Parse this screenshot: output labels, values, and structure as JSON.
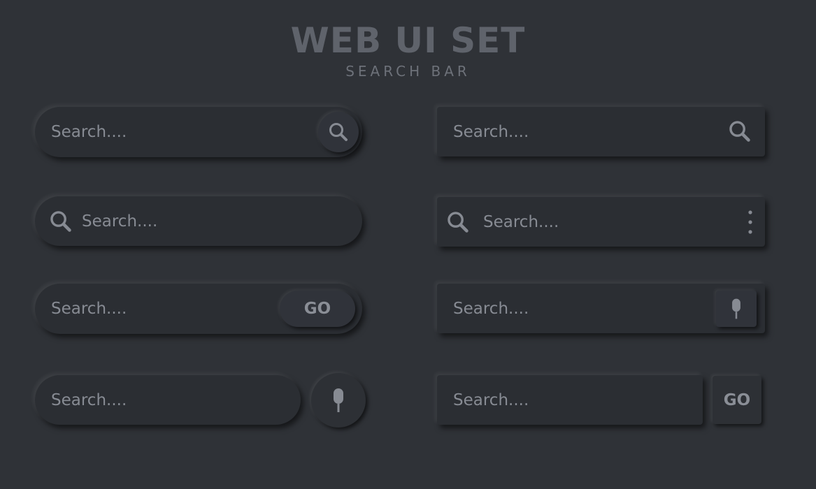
{
  "header": {
    "title": "WEB UI SET",
    "subtitle": "SEARCH BAR"
  },
  "search_bars": {
    "left_1": {
      "placeholder": "Search....",
      "icon": "search-icon"
    },
    "left_2": {
      "placeholder": "Search....",
      "icon": "search-icon"
    },
    "left_3": {
      "placeholder": "Search....",
      "button_label": "GO"
    },
    "left_4": {
      "placeholder": "Search....",
      "icon": "microphone-icon"
    },
    "right_1": {
      "placeholder": "Search....",
      "icon": "search-icon"
    },
    "right_2": {
      "placeholder": "Search....",
      "icon": "search-icon",
      "menu_icon": "kebab-menu-icon"
    },
    "right_3": {
      "placeholder": "Search....",
      "icon": "microphone-icon"
    },
    "right_4": {
      "placeholder": "Search....",
      "button_label": "GO"
    }
  },
  "colors": {
    "background": "#2f3237",
    "bar": "#2b2e33",
    "text": "#878b93",
    "title": "#5f636b"
  }
}
